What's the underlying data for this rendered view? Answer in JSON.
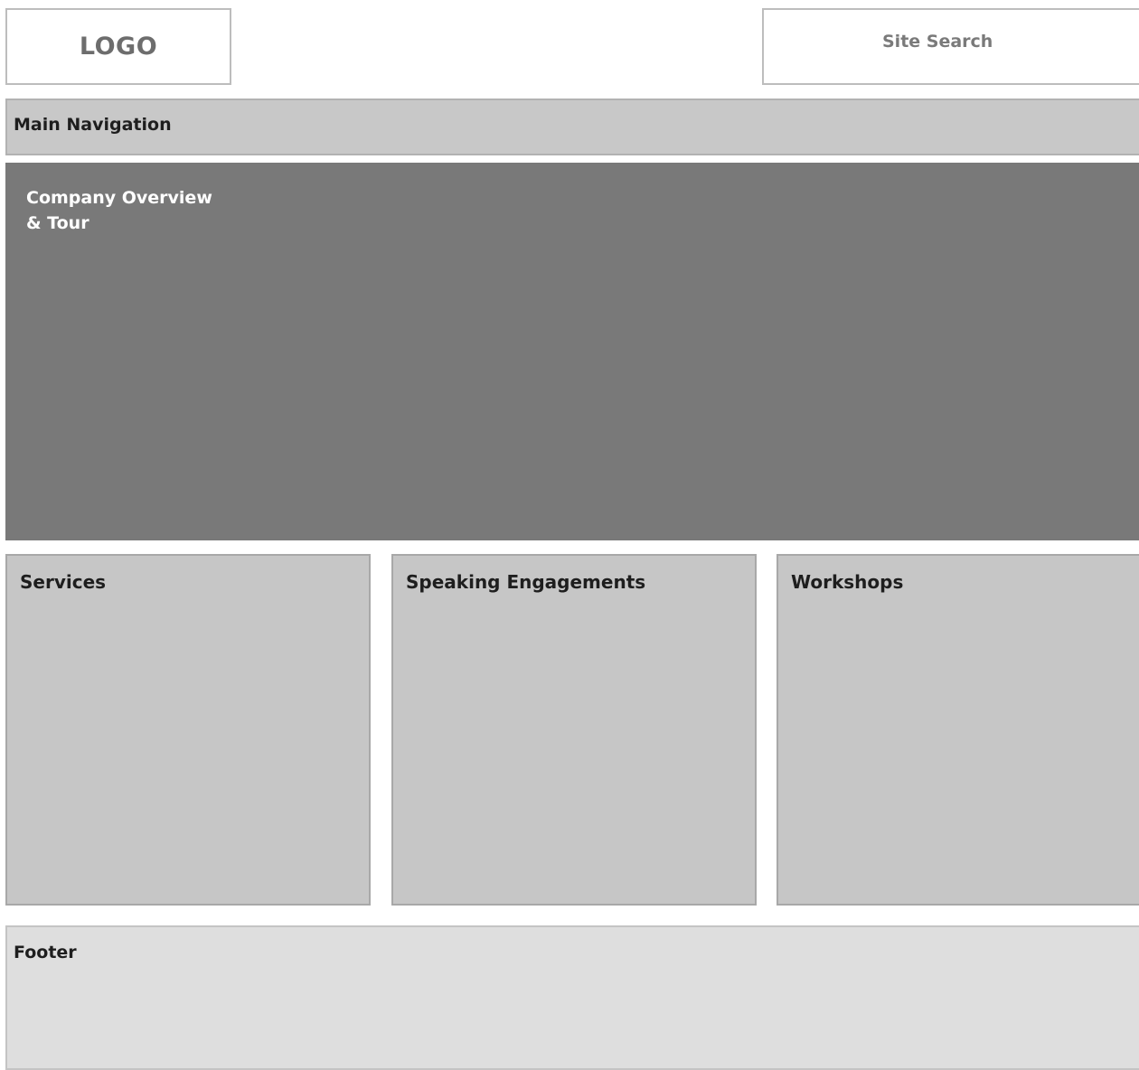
{
  "header": {
    "logo_text": "LOGO",
    "search_label": "Site Search"
  },
  "navigation": {
    "label": "Main Navigation"
  },
  "hero": {
    "title": "Company Overview\n& Tour"
  },
  "cards": [
    {
      "label": "Services"
    },
    {
      "label": "Speaking Engagements"
    },
    {
      "label": "Workshops"
    }
  ],
  "footer": {
    "label": "Footer"
  },
  "colors": {
    "background": "#ffffff",
    "nav": "#c8c8c8",
    "hero": "#797979",
    "cards": "#c6c6c6",
    "footer": "#dedede"
  }
}
